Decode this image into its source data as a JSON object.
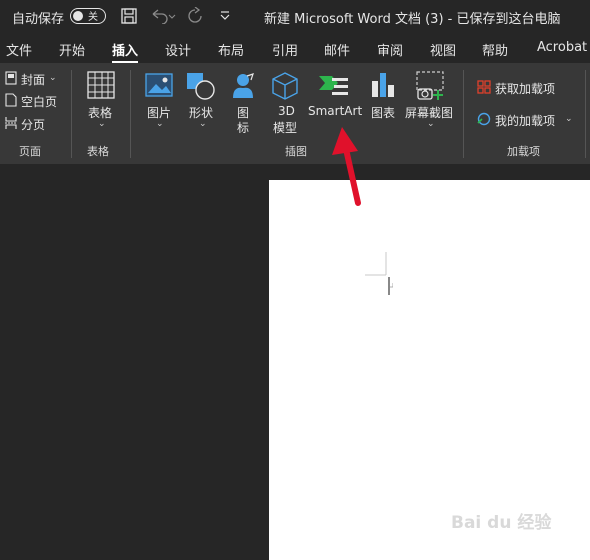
{
  "titlebar": {
    "autosave_label": "自动保存",
    "autosave_state": "关",
    "title": "新建 Microsoft Word 文档 (3) - 已保存到这台电脑"
  },
  "tabs": [
    "文件",
    "开始",
    "插入",
    "设计",
    "布局",
    "引用",
    "邮件",
    "审阅",
    "视图",
    "帮助",
    "Acrobat"
  ],
  "active_tab": "插入",
  "ribbon": {
    "pages": {
      "cover": "封面",
      "blank": "空白页",
      "break": "分页",
      "group": "页面"
    },
    "tables": {
      "table": "表格",
      "group": "表格"
    },
    "illustrations": {
      "picture": "图片",
      "shapes": "形状",
      "icons": "图\n标",
      "icons_l1": "图",
      "icons_l2": "标",
      "model_l1": "3D",
      "model_l2": "模型",
      "smartart": "SmartArt",
      "chart": "图表",
      "screenshot": "屏幕截图",
      "group": "插图"
    },
    "addins": {
      "get": "获取加载项",
      "mine": "我的加载项",
      "group": "加载项"
    }
  },
  "watermark": "Bai du 经验",
  "colors": {
    "accent_red": "#e0112b",
    "ribbon_bg": "#383838",
    "title_bg": "#262626"
  }
}
